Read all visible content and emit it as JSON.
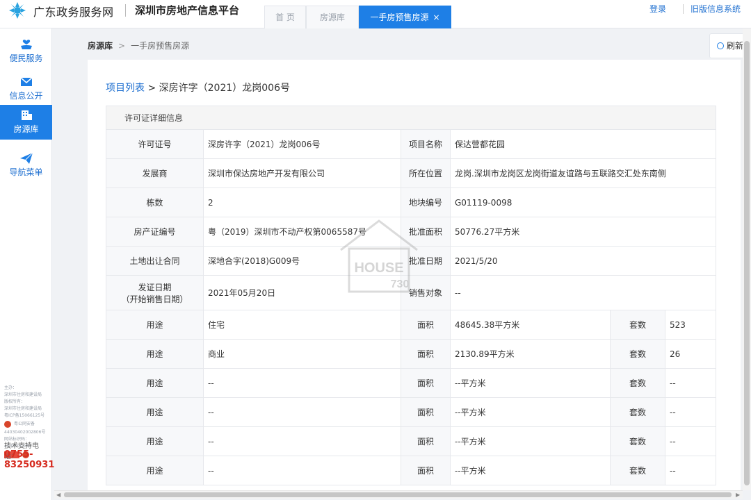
{
  "header": {
    "gov_site": "广东政务服务网",
    "platform": "深圳市房地产信息平台",
    "tabs": [
      {
        "label": "首 页"
      },
      {
        "label": "房源库"
      },
      {
        "label": "一手房预售房源",
        "close": "×"
      }
    ],
    "login": "登录",
    "old_system": "旧版信息系统"
  },
  "sidebar": {
    "items": [
      {
        "label": "便民服务",
        "icon": "hand-heart-icon"
      },
      {
        "label": "信息公开",
        "icon": "envelope-icon"
      },
      {
        "label": "房源库",
        "icon": "building-icon"
      },
      {
        "label": "导航菜单",
        "icon": "paper-plane-icon"
      }
    ],
    "footer": {
      "sponsor_label": "主办：",
      "sponsor": "深圳市住房和建设局",
      "copyright_label": "版权所有：",
      "copyright": "深圳市住房和建设局",
      "icp": "粤ICP备15066125号",
      "police_label": "粤公网安备",
      "police_no": "44030402002806号",
      "site_code_label": "网站标识码：",
      "site_code": "4403000008",
      "support_label": "技术支持电话：",
      "support_phone": "0755-83250931"
    }
  },
  "breadcrumb": {
    "level1": "房源库",
    "separator": ">",
    "level2": "一手房预售房源"
  },
  "refresh_label": "刷新",
  "project": {
    "list_link": "项目列表",
    "separator": ">",
    "permit": "深房许字（2021）龙岗006号"
  },
  "details": {
    "section_title": "许可证详细信息",
    "rows": [
      {
        "l1": "许可证号",
        "v1": "深房许字（2021）龙岗006号",
        "l2": "项目名称",
        "v2": "保达营都花园"
      },
      {
        "l1": "发展商",
        "v1": "深圳市保达房地产开发有限公司",
        "l2": "所在位置",
        "v2": "龙岗.深圳市龙岗区龙岗街道友谊路与五联路交汇处东南侧"
      },
      {
        "l1": "栋数",
        "v1": "2",
        "l2": "地块编号",
        "v2": "G01119-0098"
      },
      {
        "l1": "房产证编号",
        "v1": "粤（2019）深圳市不动产权第0065587号",
        "l2": "批准面积",
        "v2": "50776.27平方米"
      },
      {
        "l1": "土地出让合同",
        "v1": "深地合字(2018)G009号",
        "l2": "批准日期",
        "v2": "2021/5/20"
      },
      {
        "l1": "发证日期",
        "l1b": "（开始销售日期）",
        "v1": "2021年05月20日",
        "l2": "销售对象",
        "v2": "--"
      }
    ],
    "usage_rows": [
      {
        "use_label": "用途",
        "use": "住宅",
        "area_label": "面积",
        "area": "48645.38平方米",
        "units_label": "套数",
        "units": "523"
      },
      {
        "use_label": "用途",
        "use": "商业",
        "area_label": "面积",
        "area": "2130.89平方米",
        "units_label": "套数",
        "units": "26"
      },
      {
        "use_label": "用途",
        "use": "--",
        "area_label": "面积",
        "area": "--平方米",
        "units_label": "套数",
        "units": "--"
      },
      {
        "use_label": "用途",
        "use": "--",
        "area_label": "面积",
        "area": "--平方米",
        "units_label": "套数",
        "units": "--"
      },
      {
        "use_label": "用途",
        "use": "--",
        "area_label": "面积",
        "area": "--平方米",
        "units_label": "套数",
        "units": "--"
      },
      {
        "use_label": "用途",
        "use": "--",
        "area_label": "面积",
        "area": "--平方米",
        "units_label": "套数",
        "units": "--"
      }
    ]
  },
  "watermark": {
    "brand": "HOUSE",
    "number": "730"
  },
  "colors": {
    "accent": "#1e7fe6",
    "link": "#1e6fd0",
    "phone": "#d62b1f"
  }
}
